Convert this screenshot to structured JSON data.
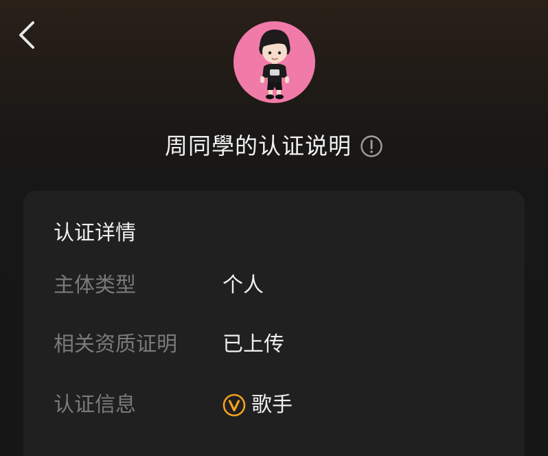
{
  "header": {
    "back_icon": "chevron-left-icon",
    "avatar_icon": "cartoon-boy-avatar"
  },
  "title": {
    "text": "周同學的认证说明",
    "info_icon": "info-circle-icon"
  },
  "details": {
    "section_title": "认证详情",
    "rows": [
      {
        "label": "主体类型",
        "value": "个人"
      },
      {
        "label": "相关资质证明",
        "value": "已上传"
      },
      {
        "label": "认证信息",
        "value": "歌手",
        "badge_icon": "v-verified-badge-icon"
      }
    ]
  },
  "colors": {
    "background": "#161616",
    "card": "#202020",
    "avatar_background": "#f07aa8",
    "badge": "#f2a21c",
    "label_text": "#7a7a7a",
    "value_text": "#efefef"
  }
}
